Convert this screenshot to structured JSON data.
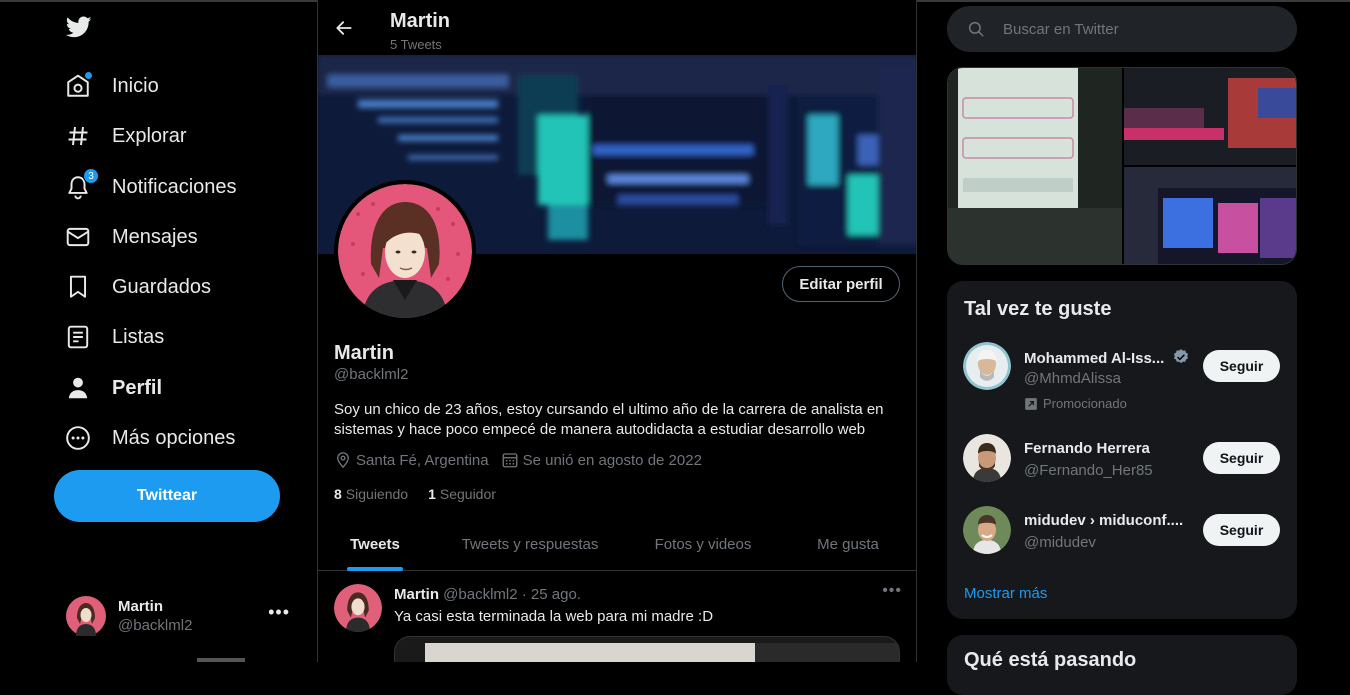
{
  "nav": {
    "items": [
      {
        "label": "Inicio",
        "icon": "home-icon"
      },
      {
        "label": "Explorar",
        "icon": "hashtag-icon"
      },
      {
        "label": "Notificaciones",
        "icon": "bell-icon",
        "badge": "3"
      },
      {
        "label": "Mensajes",
        "icon": "envelope-icon"
      },
      {
        "label": "Guardados",
        "icon": "bookmark-icon"
      },
      {
        "label": "Listas",
        "icon": "list-icon"
      },
      {
        "label": "Perfil",
        "icon": "person-icon"
      },
      {
        "label": "Más opciones",
        "icon": "more-circle-icon"
      }
    ],
    "tweet_button": "Twittear",
    "account": {
      "name": "Martin",
      "handle": "@backlml2"
    }
  },
  "header": {
    "title": "Martin",
    "subtitle": "5 Tweets"
  },
  "profile": {
    "edit_button": "Editar perfil",
    "name": "Martin",
    "handle": "@backlml2",
    "bio": "Soy un chico de 23 años, estoy cursando el ultimo año de la carrera de analista en sistemas y hace poco empecé de manera autodidacta a estudiar desarrollo web",
    "location": "Santa Fé, Argentina",
    "joined": "Se unió en agosto de 2022",
    "following_count": "8",
    "following_label": "Siguiendo",
    "followers_count": "1",
    "followers_label": "Seguidor"
  },
  "tabs": [
    "Tweets",
    "Tweets y respuestas",
    "Fotos y videos",
    "Me gusta"
  ],
  "tweet": {
    "name": "Martin",
    "meta": "@backlml2 · 25 ago.",
    "text": "Ya casi esta terminada la web para mi madre :D"
  },
  "search": {
    "placeholder": "Buscar en Twitter"
  },
  "suggestions": {
    "title": "Tal vez te guste",
    "follow_label": "Seguir",
    "show_more": "Mostrar más",
    "people": [
      {
        "name": "Mohammed Al-Iss...",
        "handle": "@MhmdAlissa",
        "verified": true,
        "promo": "Promocionado"
      },
      {
        "name": "Fernando Herrera",
        "handle": "@Fernando_Her85"
      },
      {
        "name": "midudev › miduconf....",
        "handle": "@midudev"
      }
    ]
  },
  "happening": {
    "title": "Qué está pasando"
  },
  "colors": {
    "accent": "#1d9bf0",
    "background": "#000000",
    "card": "#16181c",
    "muted": "#71767b"
  }
}
